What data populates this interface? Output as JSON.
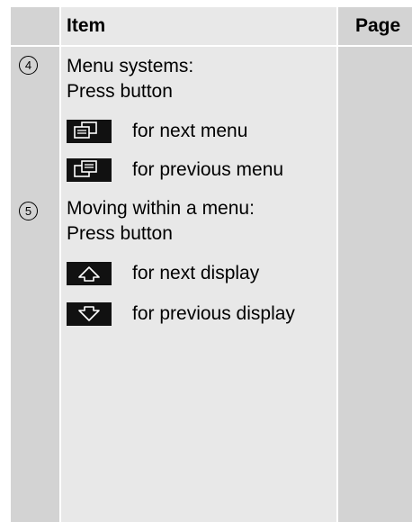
{
  "table": {
    "header": {
      "item": "Item",
      "page": "Page"
    },
    "rows": [
      {
        "number": "4",
        "line1": "Menu systems:",
        "line2": "Press button",
        "buttons": [
          {
            "icon": "next-menu-icon",
            "label": "for next menu"
          },
          {
            "icon": "previous-menu-icon",
            "label": "for previous menu"
          }
        ]
      },
      {
        "number": "5",
        "line1": "Moving within a menu:",
        "line2": "Press button",
        "buttons": [
          {
            "icon": "up-arrow-icon",
            "label": "for next display"
          },
          {
            "icon": "down-arrow-icon",
            "label": "for previous display"
          }
        ]
      }
    ]
  }
}
